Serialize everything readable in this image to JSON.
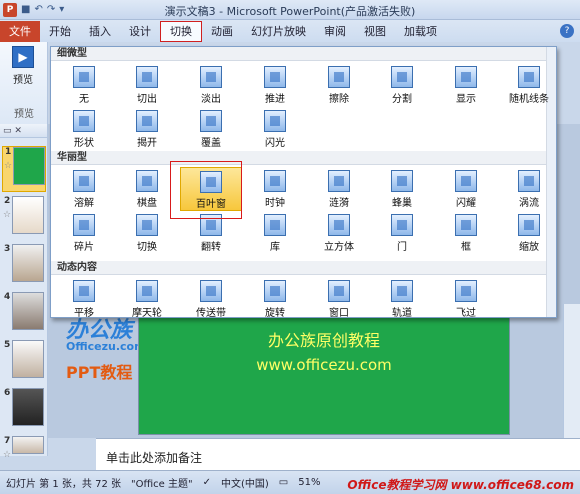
{
  "window": {
    "title": "演示文稿3 - Microsoft PowerPoint(产品激活失败)"
  },
  "ribbon_tabs": {
    "file": "文件",
    "items": [
      "开始",
      "插入",
      "设计",
      "切换",
      "动画",
      "幻灯片放映",
      "审阅",
      "视图",
      "加载项"
    ]
  },
  "ribbon_left": {
    "preview_label": "预览",
    "group_label": "预览"
  },
  "gallery": {
    "sections": [
      {
        "label": "细微型",
        "items": [
          "无",
          "切出",
          "淡出",
          "推进",
          "擦除",
          "分割",
          "显示",
          "随机线条",
          "形状",
          "揭开",
          "覆盖",
          "闪光"
        ]
      },
      {
        "label": "华丽型",
        "items": [
          "溶解",
          "棋盘",
          "百叶窗",
          "时钟",
          "涟漪",
          "蜂巢",
          "闪耀",
          "涡流",
          "碎片",
          "切换",
          "翻转",
          "库",
          "立方体",
          "门",
          "框",
          "缩放"
        ]
      },
      {
        "label": "动态内容",
        "items": [
          "平移",
          "摩天轮",
          "传送带",
          "旋转",
          "窗口",
          "轨道",
          "飞过"
        ]
      }
    ],
    "selected": "百叶窗"
  },
  "slides_panel": {
    "slide_numbers": [
      "1",
      "2",
      "3",
      "4",
      "5",
      "6",
      "7"
    ]
  },
  "brand": {
    "main": "办公族",
    "sub": "Officezu.com",
    "ppt": "PPT教程"
  },
  "slide": {
    "line1": "办公族原创教程",
    "line2": "www.officezu.com"
  },
  "notes": {
    "placeholder": "单击此处添加备注"
  },
  "status": {
    "slide_info": "幻灯片 第 1 张，共 72 张",
    "theme": "\"Office 主题\"",
    "language": "中文(中国)",
    "zoom": "51%"
  },
  "watermark": "Office教程学习网 www.office68.com"
}
